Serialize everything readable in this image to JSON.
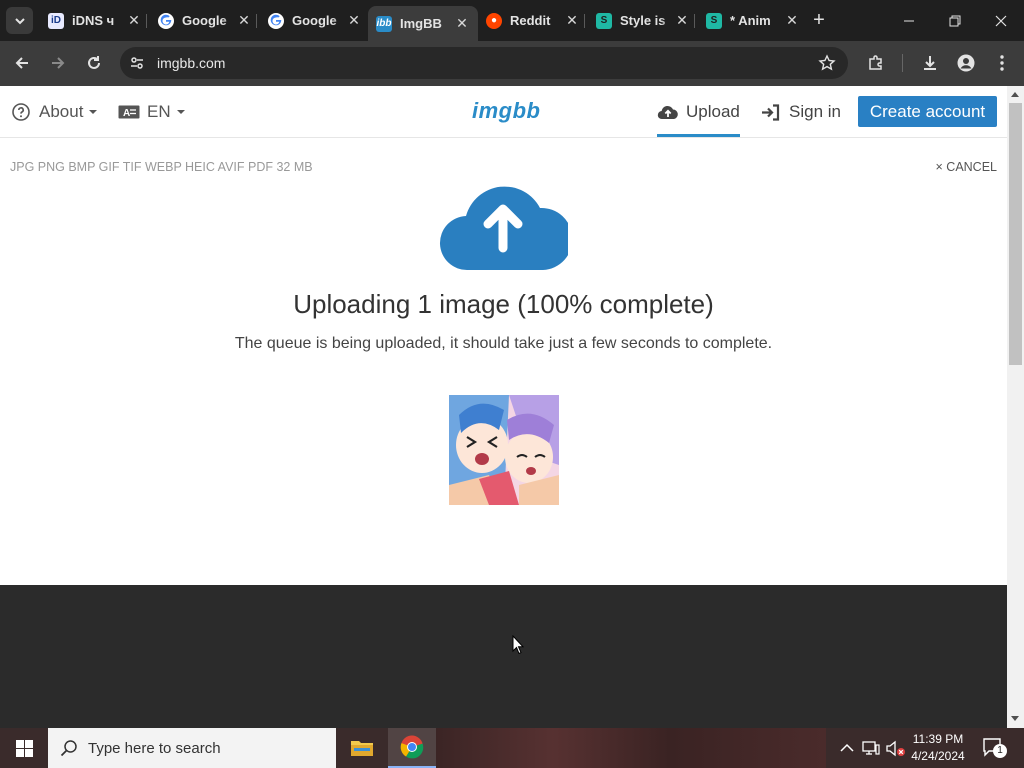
{
  "browser": {
    "tabs": [
      {
        "title": "iDNS ч",
        "favicon": "idns-icon",
        "active": false
      },
      {
        "title": "Google",
        "favicon": "google-icon",
        "active": false
      },
      {
        "title": "Google",
        "favicon": "google-icon",
        "active": false
      },
      {
        "title": "ImgBB",
        "favicon": "imgbb-icon",
        "active": true
      },
      {
        "title": "Reddit",
        "favicon": "reddit-icon",
        "active": false
      },
      {
        "title": "Style is",
        "favicon": "s-icon",
        "active": false
      },
      {
        "title": "* Anim",
        "favicon": "s-icon",
        "active": false
      }
    ],
    "url": "imgbb.com"
  },
  "site": {
    "nav_about": "About",
    "nav_lang": "EN",
    "logo": "imgbb",
    "nav_upload": "Upload",
    "nav_signin": "Sign in",
    "nav_create": "Create account",
    "formats": "JPG PNG BMP GIF TIF WEBP HEIC AVIF PDF  32 MB",
    "cancel": "× CANCEL",
    "upload_title": "Uploading 1 image (100% complete)",
    "upload_desc": "The queue is being uploaded, it should take just a few seconds to complete.",
    "upload_progress_percent": 100
  },
  "taskbar": {
    "search_placeholder": "Type here to search",
    "time": "11:39 PM",
    "date": "4/24/2024",
    "notification_count": "1"
  },
  "colors": {
    "accent": "#2a8cc8",
    "button": "#2980c4",
    "chrome_dark": "#1f1f1f"
  }
}
